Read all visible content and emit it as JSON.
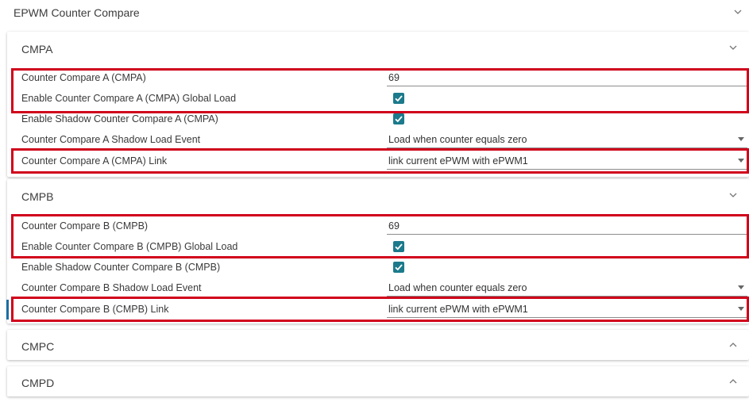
{
  "header": {
    "title": "EPWM Counter Compare"
  },
  "cmpa": {
    "title": "CMPA",
    "rows": [
      {
        "label": "Counter Compare A (CMPA)",
        "value": "69"
      },
      {
        "label": "Enable Counter Compare A (CMPA) Global Load",
        "checked": true
      },
      {
        "label": "Enable Shadow Counter Compare A (CMPA)",
        "checked": true
      },
      {
        "label": "Counter Compare A Shadow Load Event",
        "value": "Load when counter equals zero"
      },
      {
        "label": "Counter Compare A (CMPA) Link",
        "value": "link current ePWM with ePWM1"
      }
    ]
  },
  "cmpb": {
    "title": "CMPB",
    "rows": [
      {
        "label": "Counter Compare B (CMPB)",
        "value": "69"
      },
      {
        "label": "Enable Counter Compare B (CMPB) Global Load",
        "checked": true
      },
      {
        "label": "Enable Shadow Counter Compare B (CMPB)",
        "checked": true
      },
      {
        "label": "Counter Compare B Shadow Load Event",
        "value": "Load when counter equals zero"
      },
      {
        "label": "Counter Compare B (CMPB) Link",
        "value": "link current ePWM with ePWM1"
      }
    ]
  },
  "cmpc": {
    "title": "CMPC"
  },
  "cmpd": {
    "title": "CMPD"
  },
  "colors": {
    "accent": "#1b7a8b",
    "highlight": "#d0021b",
    "focus": "#1b6fa5"
  }
}
